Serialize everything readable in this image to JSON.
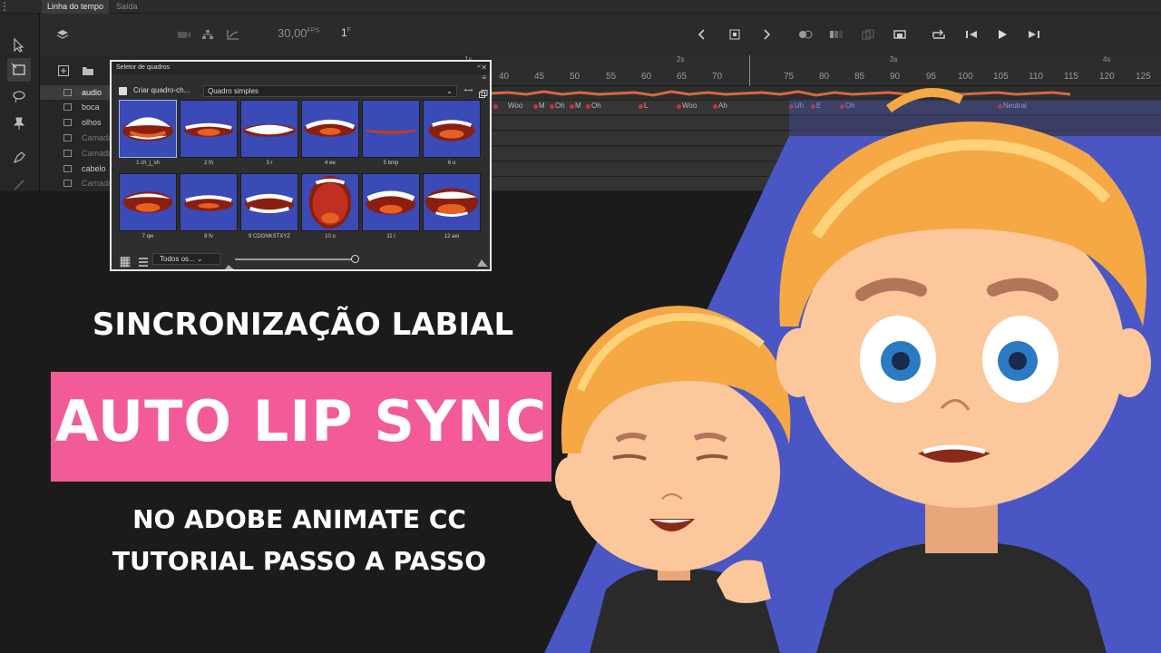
{
  "tabs": [
    {
      "label": "Linha do tempo"
    },
    {
      "label": "Saída"
    }
  ],
  "timeline": {
    "fps": "30,00",
    "fps_unit": "FPS",
    "frame": "1",
    "frame_unit": "F",
    "seconds": [
      "1s",
      "2s",
      "3s",
      "4s"
    ],
    "ticks": [
      "40",
      "45",
      "50",
      "55",
      "60",
      "65",
      "70",
      "75",
      "80",
      "85",
      "90",
      "95",
      "100",
      "105",
      "110",
      "115",
      "120",
      "125"
    ]
  },
  "layers": [
    {
      "name": "audio",
      "state": "selected"
    },
    {
      "name": "boca",
      "state": "normal"
    },
    {
      "name": "olhos",
      "state": "normal"
    },
    {
      "name": "Camada",
      "state": "dim"
    },
    {
      "name": "Camada",
      "state": "dim"
    },
    {
      "name": "cabelo",
      "state": "normal"
    },
    {
      "name": "Camada",
      "state": "dim"
    }
  ],
  "keyframe_labels": [
    "Woo",
    "M",
    "Oh",
    "M",
    "Oh",
    "L",
    "Woo",
    "Ah",
    "Uh",
    "E",
    "Oh",
    "Neutral"
  ],
  "frame_picker": {
    "title": "Seletor de quadros",
    "create_label": "Criar quadro-ch...",
    "mode": "Quadro simples",
    "filter": "Todos os...",
    "thumbs": [
      {
        "label": "1 ch_j_sh"
      },
      {
        "label": "2 th"
      },
      {
        "label": "3 r"
      },
      {
        "label": "4 ee"
      },
      {
        "label": "5 bmp"
      },
      {
        "label": "6 u"
      },
      {
        "label": "7 qw"
      },
      {
        "label": "8 fv"
      },
      {
        "label": "9 CDGNKSTXYZ"
      },
      {
        "label": "10 o"
      },
      {
        "label": "11 l"
      },
      {
        "label": "12 aei"
      }
    ]
  },
  "overlay": {
    "line1": "SINCRONIZAÇÃO LABIAL",
    "line2": "AUTO LIP SYNC",
    "line3": "NO ADOBE ANIMATE CC",
    "line4": "TUTORIAL PASSO A PASSO"
  },
  "colors": {
    "pink": "#f25b98",
    "stage_blue": "#4a56c4",
    "hair": "#f5a844",
    "skin": "#fbc79b",
    "shirt": "#2a2a2a"
  }
}
